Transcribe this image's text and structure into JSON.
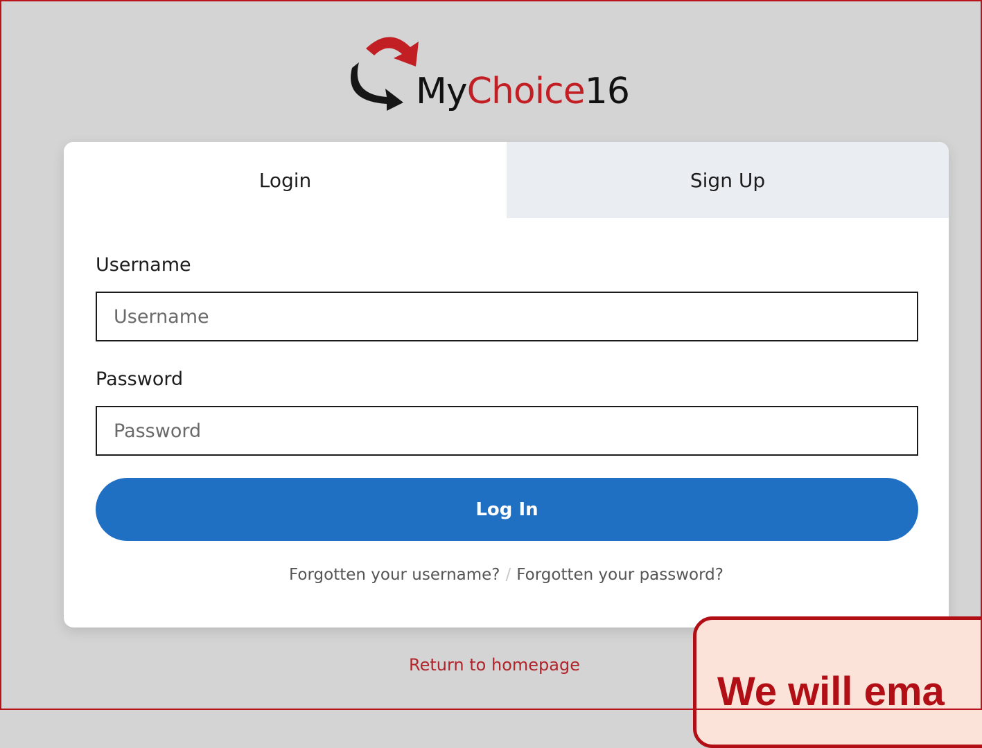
{
  "logo": {
    "text_my": "My",
    "text_choice": "Choice",
    "text_num": "16"
  },
  "tabs": {
    "login": "Login",
    "signup": "Sign Up"
  },
  "form": {
    "username_label": "Username",
    "username_placeholder": "Username",
    "password_label": "Password",
    "password_placeholder": "Password",
    "login_button": "Log In"
  },
  "links": {
    "forgot_username": "Forgotten your username?",
    "separator": "/",
    "forgot_password": "Forgotten your password?",
    "return_home": "Return to homepage"
  },
  "callout": {
    "text": "We will ema"
  },
  "colors": {
    "primary_button": "#1f6fc3",
    "brand_red": "#c21f25",
    "frame_border": "#b8141b",
    "callout_bg": "#fbe3da"
  }
}
